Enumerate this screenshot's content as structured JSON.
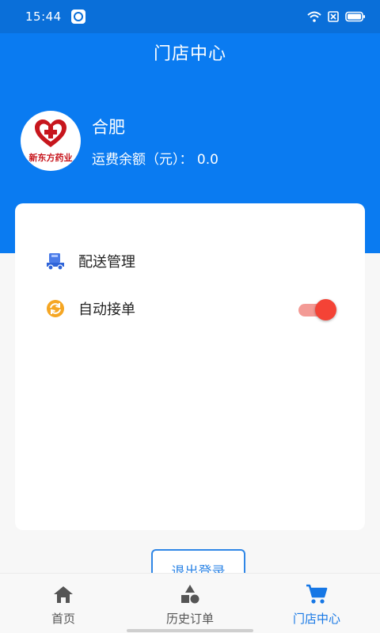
{
  "status_bar": {
    "time": "15:44",
    "icons": [
      "app-icon",
      "wifi-icon",
      "sim-icon",
      "battery-icon"
    ]
  },
  "header": {
    "title": "门店中心"
  },
  "profile": {
    "logo_text": "新东方药业",
    "store_name": "合肥",
    "balance_label": "运费余额（元）：",
    "balance_value": "0.0"
  },
  "menu": {
    "items": [
      {
        "label": "配送管理",
        "icon": "delivery-truck-icon"
      },
      {
        "label": "自动接单",
        "icon": "refresh-icon",
        "toggle_on": true
      }
    ]
  },
  "logout": {
    "label": "退出登录"
  },
  "tabs": [
    {
      "label": "首页",
      "icon": "home-icon",
      "active": false
    },
    {
      "label": "历史订单",
      "icon": "shapes-icon",
      "active": false
    },
    {
      "label": "门店中心",
      "icon": "cart-icon",
      "active": true
    }
  ],
  "colors": {
    "brand_blue": "#0a7bf1",
    "active_tab": "#1677e5",
    "toggle_on": "#f44336",
    "logo_red": "#c7161d"
  }
}
